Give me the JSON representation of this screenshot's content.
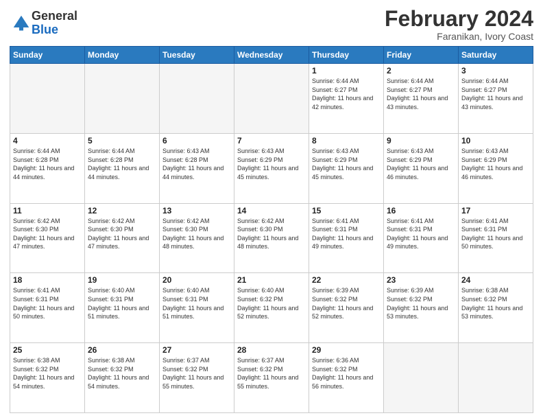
{
  "header": {
    "logo_general": "General",
    "logo_blue": "Blue",
    "title": "February 2024",
    "subtitle": "Faranikan, Ivory Coast"
  },
  "days_of_week": [
    "Sunday",
    "Monday",
    "Tuesday",
    "Wednesday",
    "Thursday",
    "Friday",
    "Saturday"
  ],
  "weeks": [
    [
      {
        "num": "",
        "info": ""
      },
      {
        "num": "",
        "info": ""
      },
      {
        "num": "",
        "info": ""
      },
      {
        "num": "",
        "info": ""
      },
      {
        "num": "1",
        "info": "Sunrise: 6:44 AM\nSunset: 6:27 PM\nDaylight: 11 hours and 42 minutes."
      },
      {
        "num": "2",
        "info": "Sunrise: 6:44 AM\nSunset: 6:27 PM\nDaylight: 11 hours and 43 minutes."
      },
      {
        "num": "3",
        "info": "Sunrise: 6:44 AM\nSunset: 6:27 PM\nDaylight: 11 hours and 43 minutes."
      }
    ],
    [
      {
        "num": "4",
        "info": "Sunrise: 6:44 AM\nSunset: 6:28 PM\nDaylight: 11 hours and 44 minutes."
      },
      {
        "num": "5",
        "info": "Sunrise: 6:44 AM\nSunset: 6:28 PM\nDaylight: 11 hours and 44 minutes."
      },
      {
        "num": "6",
        "info": "Sunrise: 6:43 AM\nSunset: 6:28 PM\nDaylight: 11 hours and 44 minutes."
      },
      {
        "num": "7",
        "info": "Sunrise: 6:43 AM\nSunset: 6:29 PM\nDaylight: 11 hours and 45 minutes."
      },
      {
        "num": "8",
        "info": "Sunrise: 6:43 AM\nSunset: 6:29 PM\nDaylight: 11 hours and 45 minutes."
      },
      {
        "num": "9",
        "info": "Sunrise: 6:43 AM\nSunset: 6:29 PM\nDaylight: 11 hours and 46 minutes."
      },
      {
        "num": "10",
        "info": "Sunrise: 6:43 AM\nSunset: 6:29 PM\nDaylight: 11 hours and 46 minutes."
      }
    ],
    [
      {
        "num": "11",
        "info": "Sunrise: 6:42 AM\nSunset: 6:30 PM\nDaylight: 11 hours and 47 minutes."
      },
      {
        "num": "12",
        "info": "Sunrise: 6:42 AM\nSunset: 6:30 PM\nDaylight: 11 hours and 47 minutes."
      },
      {
        "num": "13",
        "info": "Sunrise: 6:42 AM\nSunset: 6:30 PM\nDaylight: 11 hours and 48 minutes."
      },
      {
        "num": "14",
        "info": "Sunrise: 6:42 AM\nSunset: 6:30 PM\nDaylight: 11 hours and 48 minutes."
      },
      {
        "num": "15",
        "info": "Sunrise: 6:41 AM\nSunset: 6:31 PM\nDaylight: 11 hours and 49 minutes."
      },
      {
        "num": "16",
        "info": "Sunrise: 6:41 AM\nSunset: 6:31 PM\nDaylight: 11 hours and 49 minutes."
      },
      {
        "num": "17",
        "info": "Sunrise: 6:41 AM\nSunset: 6:31 PM\nDaylight: 11 hours and 50 minutes."
      }
    ],
    [
      {
        "num": "18",
        "info": "Sunrise: 6:41 AM\nSunset: 6:31 PM\nDaylight: 11 hours and 50 minutes."
      },
      {
        "num": "19",
        "info": "Sunrise: 6:40 AM\nSunset: 6:31 PM\nDaylight: 11 hours and 51 minutes."
      },
      {
        "num": "20",
        "info": "Sunrise: 6:40 AM\nSunset: 6:31 PM\nDaylight: 11 hours and 51 minutes."
      },
      {
        "num": "21",
        "info": "Sunrise: 6:40 AM\nSunset: 6:32 PM\nDaylight: 11 hours and 52 minutes."
      },
      {
        "num": "22",
        "info": "Sunrise: 6:39 AM\nSunset: 6:32 PM\nDaylight: 11 hours and 52 minutes."
      },
      {
        "num": "23",
        "info": "Sunrise: 6:39 AM\nSunset: 6:32 PM\nDaylight: 11 hours and 53 minutes."
      },
      {
        "num": "24",
        "info": "Sunrise: 6:38 AM\nSunset: 6:32 PM\nDaylight: 11 hours and 53 minutes."
      }
    ],
    [
      {
        "num": "25",
        "info": "Sunrise: 6:38 AM\nSunset: 6:32 PM\nDaylight: 11 hours and 54 minutes."
      },
      {
        "num": "26",
        "info": "Sunrise: 6:38 AM\nSunset: 6:32 PM\nDaylight: 11 hours and 54 minutes."
      },
      {
        "num": "27",
        "info": "Sunrise: 6:37 AM\nSunset: 6:32 PM\nDaylight: 11 hours and 55 minutes."
      },
      {
        "num": "28",
        "info": "Sunrise: 6:37 AM\nSunset: 6:32 PM\nDaylight: 11 hours and 55 minutes."
      },
      {
        "num": "29",
        "info": "Sunrise: 6:36 AM\nSunset: 6:32 PM\nDaylight: 11 hours and 56 minutes."
      },
      {
        "num": "",
        "info": ""
      },
      {
        "num": "",
        "info": ""
      }
    ]
  ]
}
